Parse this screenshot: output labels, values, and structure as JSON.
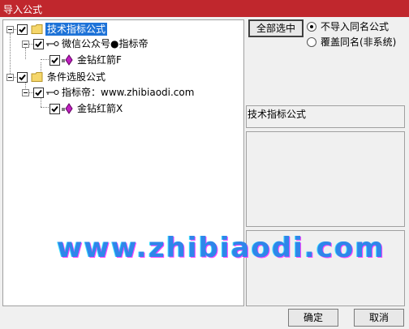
{
  "window": {
    "title": "导入公式"
  },
  "tree": {
    "nodes": [
      {
        "label": "技术指标公式",
        "icon": "folder-icon",
        "checked": true,
        "expanded": true,
        "selected": true
      },
      {
        "label": "微信公众号●指标帝",
        "icon": "key-icon",
        "checked": true,
        "expanded": true
      },
      {
        "label": "金钻红箭F",
        "icon": "diamond-icon",
        "checked": true
      },
      {
        "label": "条件选股公式",
        "icon": "folder-icon",
        "checked": true,
        "expanded": true
      },
      {
        "label": "指标帝：www.zhibiaodi.com",
        "icon": "key-icon",
        "checked": true,
        "expanded": true
      },
      {
        "label": "金钻红箭X",
        "icon": "diamond-icon",
        "checked": true
      }
    ]
  },
  "options": {
    "select_all_label": "全部选中",
    "radio_no_import": "不导入同名公式",
    "radio_overwrite": "覆盖同名(非系统)",
    "selected_option": "不导入同名公式"
  },
  "info": {
    "formula_type": "技术指标公式"
  },
  "buttons": {
    "ok": "确定",
    "cancel": "取消"
  },
  "watermark": {
    "text": "www.zhibiaodi.com"
  },
  "colors": {
    "titlebar": "#c0272d",
    "selection": "#1e73d8",
    "diamond": "#c020c0",
    "folder": "#f5d66a",
    "watermark": "#2e86ea"
  }
}
